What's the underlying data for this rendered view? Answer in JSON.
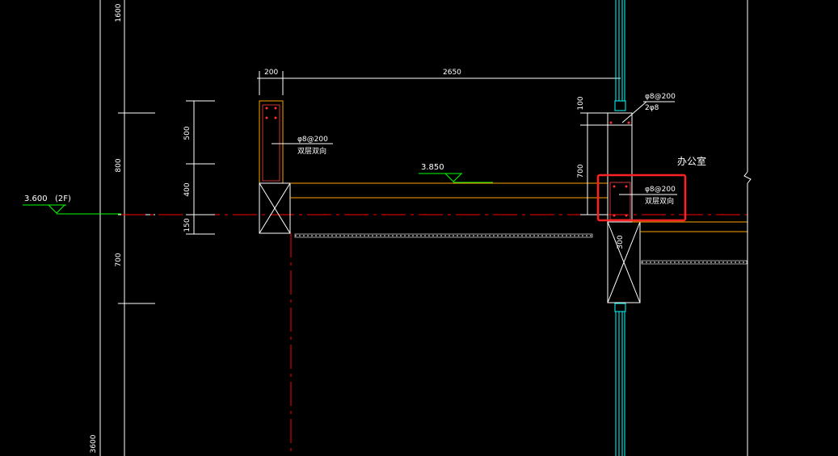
{
  "colors": {
    "background": "#000000",
    "dimension_line": "#ffffff",
    "center_line": "#ff0000",
    "beam_outline": "#ffa500",
    "glass_curtain_wall": "#00ffff",
    "level_marker": "#00ff00",
    "highlight_box": "#ff2222",
    "slab_hatch": "#c8c8c8"
  },
  "left_dims": {
    "d1600": "1600",
    "d800": "800",
    "d700": "700",
    "d3600": "3600"
  },
  "level_left": {
    "elevation": "3.600",
    "floor": "(2F)"
  },
  "level_mid": {
    "elevation": "3.850"
  },
  "beam_left_dims": {
    "d500": "500",
    "d400": "400",
    "d150": "150"
  },
  "top_dims": {
    "d200": "200",
    "d2650": "2650"
  },
  "rebar_left": {
    "spec": "φ8@200",
    "note": "双层双向"
  },
  "beam_right_dims": {
    "d100": "100",
    "d700": "700",
    "d300": "300"
  },
  "rebar_top_right": {
    "spec": "φ8@200",
    "bars": "2φ8"
  },
  "rebar_right": {
    "spec": "φ8@200",
    "note": "双层双向"
  },
  "room_label": "办公室"
}
